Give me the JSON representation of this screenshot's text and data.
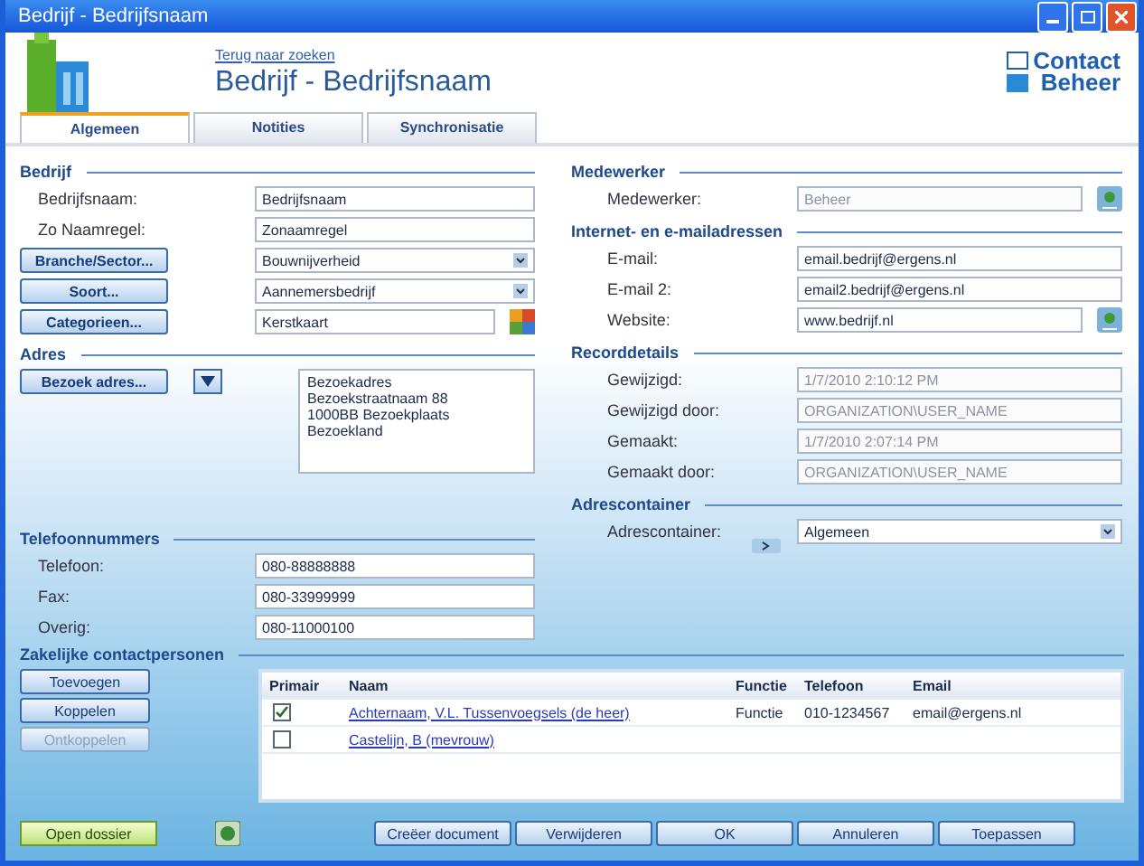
{
  "window": {
    "title": "Bedrijf - Bedrijfsnaam"
  },
  "header": {
    "back_link": "Terug naar zoeken",
    "title": "Bedrijf - Bedrijfsnaam",
    "logo_top": "Contact",
    "logo_bottom": "Beheer"
  },
  "tabs": [
    {
      "label": "Algemeen",
      "selected": true
    },
    {
      "label": "Notities",
      "selected": false
    },
    {
      "label": "Synchronisatie",
      "selected": false
    }
  ],
  "left_sections": [
    {
      "heading": "Bedrijf",
      "fields": [
        {
          "label": "Bedrijfsnaam:",
          "kind": "text",
          "value": "Bedrijfsnaam",
          "disabled": false
        },
        {
          "label": "Zo Naamregel:",
          "kind": "text",
          "value": "Zonaamregel",
          "disabled": false
        },
        {
          "button": "Branche/Sector...",
          "kind": "select",
          "value": "Bouwnijverheid",
          "disabled": false
        },
        {
          "button": "Soort...",
          "kind": "select",
          "value": "Aannemersbedrijf",
          "disabled": false
        },
        {
          "button": "Categorieen...",
          "kind": "category",
          "value": "Kerstkaart",
          "disabled": false
        }
      ]
    },
    {
      "heading": "Adres",
      "address_button": "Bezoek adres...",
      "address_lines": "Bezoekadres\nBezoekstraatnaam 88\n1000BB Bezoekplaats\nBezoekland"
    },
    {
      "heading": "Telefoonnummers",
      "fields": [
        {
          "label": "Telefoon:",
          "kind": "text",
          "value": "080-88888888",
          "disabled": false
        },
        {
          "label": "Fax:",
          "kind": "text",
          "value": "080-33999999",
          "disabled": false
        },
        {
          "label": "Overig:",
          "kind": "text",
          "value": "080-11000100",
          "disabled": false
        }
      ]
    }
  ],
  "right_sections": [
    {
      "heading": "Medewerker",
      "fields": [
        {
          "label": "Medewerker:",
          "kind": "lookup",
          "value": "Beheer",
          "disabled": true
        }
      ]
    },
    {
      "heading": "Internet- en e-mailadressen",
      "fields": [
        {
          "label": "E-mail:",
          "kind": "text",
          "value": "email.bedrijf@ergens.nl",
          "disabled": false
        },
        {
          "label": "E-mail 2:",
          "kind": "text",
          "value": "email2.bedrijf@ergens.nl",
          "disabled": false
        },
        {
          "label": "Website:",
          "kind": "lookup",
          "value": "www.bedrijf.nl",
          "disabled": false
        }
      ]
    },
    {
      "heading": "Recorddetails",
      "fields": [
        {
          "label": "Gewijzigd:",
          "kind": "text",
          "value": "1/7/2010 2:10:12 PM",
          "disabled": true
        },
        {
          "label": "Gewijzigd door:",
          "kind": "text",
          "value": "ORGANIZATION\\USER_NAME",
          "disabled": true
        },
        {
          "label": "Gemaakt:",
          "kind": "text",
          "value": "1/7/2010 2:07:14 PM",
          "disabled": true
        },
        {
          "label": "Gemaakt door:",
          "kind": "text",
          "value": "ORGANIZATION\\USER_NAME",
          "disabled": true
        }
      ]
    },
    {
      "heading": "Adrescontainer",
      "fields": [
        {
          "label": "Adrescontainer:",
          "kind": "select",
          "value": "Algemeen",
          "disabled": false
        }
      ]
    }
  ],
  "contacts": {
    "heading": "Zakelijke contactpersonen",
    "buttons": [
      {
        "label": "Toevoegen",
        "disabled": false
      },
      {
        "label": "Koppelen",
        "disabled": false
      },
      {
        "label": "Ontkoppelen",
        "disabled": true
      }
    ],
    "columns": [
      "Primair",
      "Naam",
      "Functie",
      "Telefoon",
      "Email"
    ],
    "rows": [
      {
        "primary": true,
        "name": "Achternaam, V.L. Tussenvoegsels (de heer)",
        "function": "Functie",
        "phone": "010-1234567",
        "email": "email@ergens.nl"
      },
      {
        "primary": false,
        "name": "Castelijn, B (mevrouw)"
      }
    ]
  },
  "footer": {
    "dossier_button": "Open dossier",
    "buttons": [
      "Creëer document",
      "Verwijderen",
      "OK",
      "Annuleren",
      "Toepassen"
    ]
  }
}
